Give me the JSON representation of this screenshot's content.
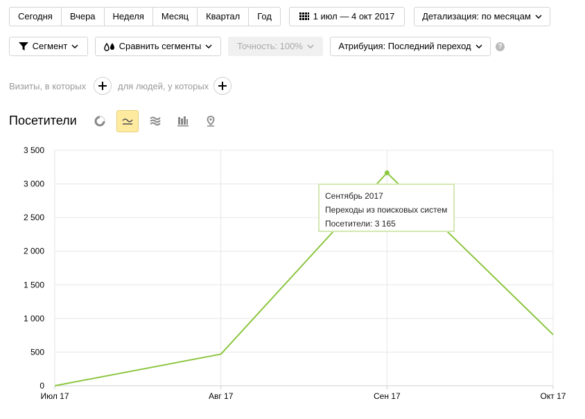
{
  "period_tabs": [
    "Сегодня",
    "Вчера",
    "Неделя",
    "Месяц",
    "Квартал",
    "Год"
  ],
  "date_range": "1 июл — 4 окт 2017",
  "detail": "Детализация: по месяцам",
  "segment_button": "Сегмент",
  "compare_button": "Сравнить сегменты",
  "accuracy_button": "Точность: 100%",
  "attribution_button": "Атрибуция: Последний переход",
  "help_symbol": "?",
  "conditions": {
    "visits_label": "Визиты, в которых",
    "people_label": "для людей, у которых"
  },
  "report_title": "Посетители",
  "view_types": [
    {
      "icon": "pie-chart-icon",
      "active": false
    },
    {
      "icon": "line-chart-icon",
      "active": true
    },
    {
      "icon": "area-chart-icon",
      "active": false
    },
    {
      "icon": "bar-chart-icon",
      "active": false
    },
    {
      "icon": "map-pin-icon",
      "active": false
    }
  ],
  "colors": {
    "series": "#8cc63f",
    "grid": "#e6e6e6",
    "tooltip_border": "#d3e8b1",
    "active_view": "#ffeba0"
  },
  "chart_data": {
    "type": "line",
    "x": [
      "Июл 17",
      "Авг 17",
      "Сен 17",
      "Окт 17"
    ],
    "series": [
      {
        "name": "Переходы из поисковых систем",
        "values": [
          0,
          470,
          3165,
          760
        ]
      }
    ],
    "ylim": [
      0,
      3500
    ],
    "yticks": [
      0,
      500,
      1000,
      1500,
      2000,
      2500,
      3000,
      3500
    ],
    "ytick_labels": [
      "0",
      "500",
      "1 000",
      "1 500",
      "2 000",
      "2 500",
      "3 000",
      "3 500"
    ],
    "grid": true,
    "tooltip": {
      "point_index": 2,
      "title": "Сентябрь 2017",
      "series_line": "Переходы из поисковых систем",
      "value_line": "Посетители: 3 165"
    }
  }
}
